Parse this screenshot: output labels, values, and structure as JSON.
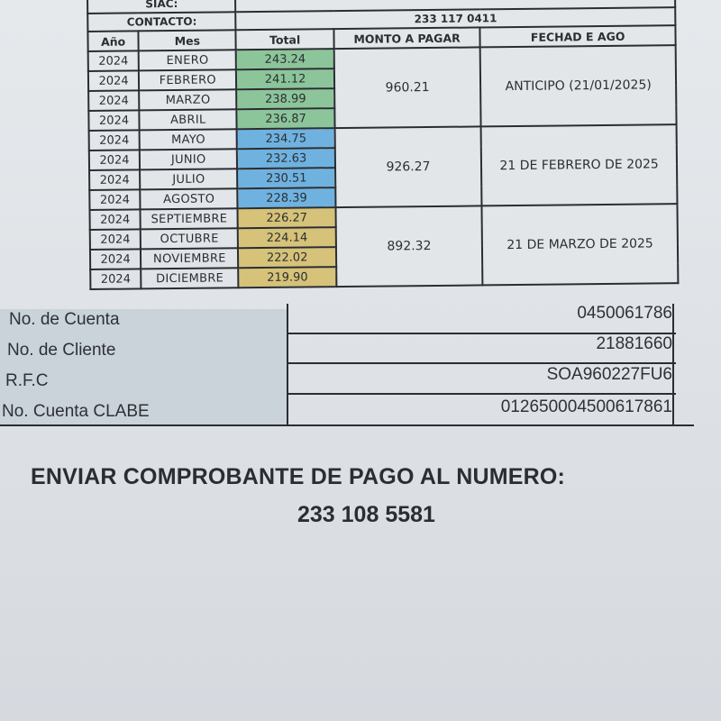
{
  "header": {
    "siac_label": "SIAC:",
    "siac_value": "",
    "contacto_label": "CONTACTO:",
    "contacto_value": "233 117 0411"
  },
  "columns": {
    "year": "Año",
    "month": "Mes",
    "total": "Total",
    "amount": "MONTO A PAGAR",
    "date": "FECHAD E AGO"
  },
  "rows": [
    {
      "year": "2024",
      "month": "ENERO",
      "total": "243.24"
    },
    {
      "year": "2024",
      "month": "FEBRERO",
      "total": "241.12"
    },
    {
      "year": "2024",
      "month": "MARZO",
      "total": "238.99"
    },
    {
      "year": "2024",
      "month": "ABRIL",
      "total": "236.87"
    },
    {
      "year": "2024",
      "month": "MAYO",
      "total": "234.75"
    },
    {
      "year": "2024",
      "month": "JUNIO",
      "total": "232.63"
    },
    {
      "year": "2024",
      "month": "JULIO",
      "total": "230.51"
    },
    {
      "year": "2024",
      "month": "AGOSTO",
      "total": "228.39"
    },
    {
      "year": "2024",
      "month": "SEPTIEMBRE",
      "total": "226.27"
    },
    {
      "year": "2024",
      "month": "OCTUBRE",
      "total": "224.14"
    },
    {
      "year": "2024",
      "month": "NOVIEMBRE",
      "total": "222.02"
    },
    {
      "year": "2024",
      "month": "DICIEMBRE",
      "total": "219.90"
    }
  ],
  "groups": [
    {
      "amount": "960.21",
      "date": "ANTICIPO (21/01/2025)",
      "color": "#8cc59a"
    },
    {
      "amount": "926.27",
      "date": "21 DE FEBRERO DE 2025",
      "color": "#6fb2e0"
    },
    {
      "amount": "892.32",
      "date": "21 DE MARZO DE 2025",
      "color": "#d6c278"
    }
  ],
  "account": {
    "cuenta_label": "No. de Cuenta",
    "cuenta_value": "0450061786",
    "cliente_label": "No. de Cliente",
    "cliente_value": "21881660",
    "rfc_label": "R.F.C",
    "rfc_value": "SOA960227FU6",
    "clabe_label": "No. Cuenta CLABE",
    "clabe_value": "012650004500617861"
  },
  "footer": {
    "instruction": "ENVIAR COMPROBANTE DE PAGO AL NUMERO:",
    "phone": "233 108 5581"
  }
}
